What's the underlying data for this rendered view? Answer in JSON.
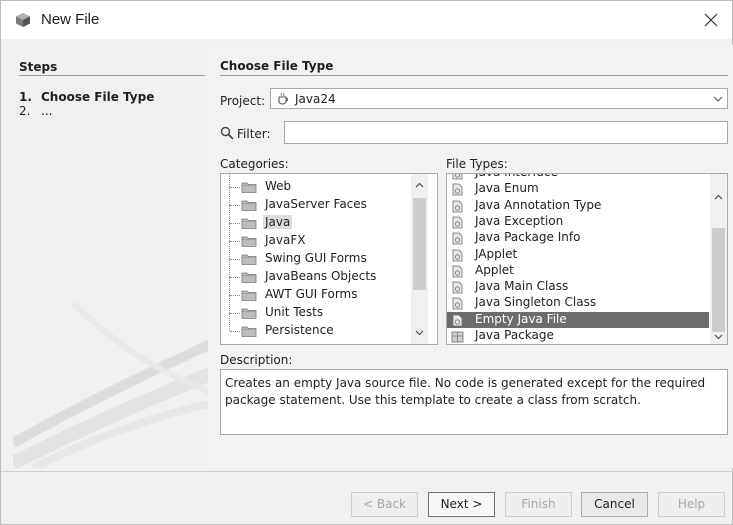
{
  "window": {
    "title": "New File"
  },
  "steps": {
    "heading": "Steps",
    "items": [
      {
        "num": "1.",
        "label": "Choose File Type"
      },
      {
        "num": "2.",
        "label": "..."
      }
    ]
  },
  "content": {
    "heading": "Choose File Type",
    "project_label": "Project:",
    "project_value": "Java24",
    "filter_label": "Filter:",
    "filter_value": "",
    "categories_label": "Categories:",
    "categories": [
      "Web",
      "JavaServer Faces",
      "Java",
      "JavaFX",
      "Swing GUI Forms",
      "JavaBeans Objects",
      "AWT GUI Forms",
      "Unit Tests",
      "Persistence"
    ],
    "categories_selected": "Java",
    "file_types_label": "File Types:",
    "file_types": [
      "Java Interface",
      "Java Enum",
      "Java Annotation Type",
      "Java Exception",
      "Java Package Info",
      "JApplet",
      "Applet",
      "Java Main Class",
      "Java Singleton Class",
      "Empty Java File",
      "Java Package"
    ],
    "file_types_selected": "Empty Java File",
    "description_label": "Description:",
    "description": "Creates an empty Java source file. No code is generated except for the required package statement. Use this template to create a class from scratch."
  },
  "buttons": {
    "back": "< Back",
    "next": "Next >",
    "finish": "Finish",
    "cancel": "Cancel",
    "help": "Help"
  },
  "icons": {
    "app": "netbeans-cube-icon",
    "close": "close-icon",
    "project": "java-cup-icon",
    "filter": "magnifier-icon",
    "category": "folder-icon",
    "file_type": "java-file-icon",
    "package": "package-icon"
  }
}
